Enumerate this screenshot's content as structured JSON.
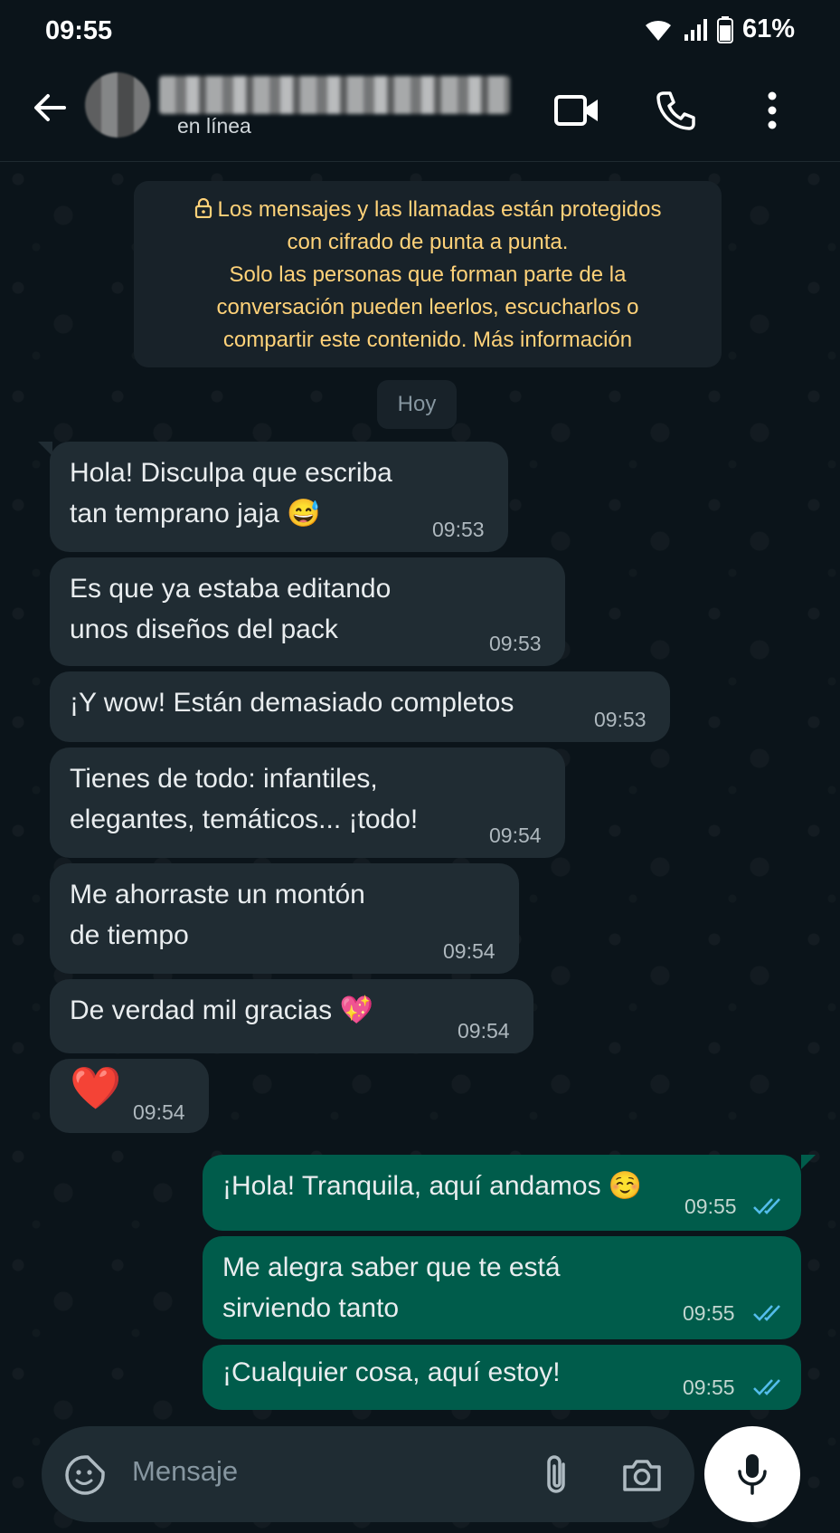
{
  "status_bar": {
    "time": "09:55",
    "battery": "61%"
  },
  "header": {
    "contact_status": "en línea",
    "icons": [
      "back-arrow-icon",
      "video-call-icon",
      "phone-icon",
      "more-vert-icon"
    ]
  },
  "encryption_notice": {
    "line1": "Los mensajes y las llamadas están protegidos",
    "line2": "con cifrado de punta a punta.",
    "line3": "Solo las personas que forman parte de la",
    "line4": "conversación pueden leerlos, escucharlos o",
    "line5": "compartir este contenido. Más información"
  },
  "date_chip": "Hoy",
  "messages": [
    {
      "dir": "in",
      "text": "Hola! Disculpa que escriba\ntan temprano jaja 😅",
      "time": "09:53"
    },
    {
      "dir": "in",
      "text": "Es que ya estaba editando\nunos diseños del pack",
      "time": "09:53"
    },
    {
      "dir": "in",
      "text": "¡Y wow! Están demasiado completos",
      "time": "09:53"
    },
    {
      "dir": "in",
      "text": "Tienes de todo: infantiles,\nelegantes, temáticos... ¡todo!",
      "time": "09:54"
    },
    {
      "dir": "in",
      "text": "Me ahorraste un montón\nde tiempo",
      "time": "09:54"
    },
    {
      "dir": "in",
      "text": "De verdad mil gracias 💖",
      "time": "09:54"
    },
    {
      "dir": "in",
      "text": "❤️",
      "time": "09:54"
    },
    {
      "dir": "out",
      "text": "¡Hola! Tranquila, aquí andamos ☺️",
      "time": "09:55"
    },
    {
      "dir": "out",
      "text": "Me alegra saber que te está\nsirviendo tanto",
      "time": "09:55"
    },
    {
      "dir": "out",
      "text": "¡Cualquier cosa, aquí estoy!",
      "time": "09:55"
    }
  ],
  "composer": {
    "placeholder": "Mensaje",
    "icons": [
      "sticker-icon",
      "attach-icon",
      "camera-icon",
      "mic-icon"
    ]
  },
  "colors": {
    "background": "#0b141a",
    "incoming_bubble": "#202c33",
    "outgoing_bubble": "#005c4b",
    "notice_text": "#ffd279",
    "read_ticks": "#53bdeb"
  }
}
